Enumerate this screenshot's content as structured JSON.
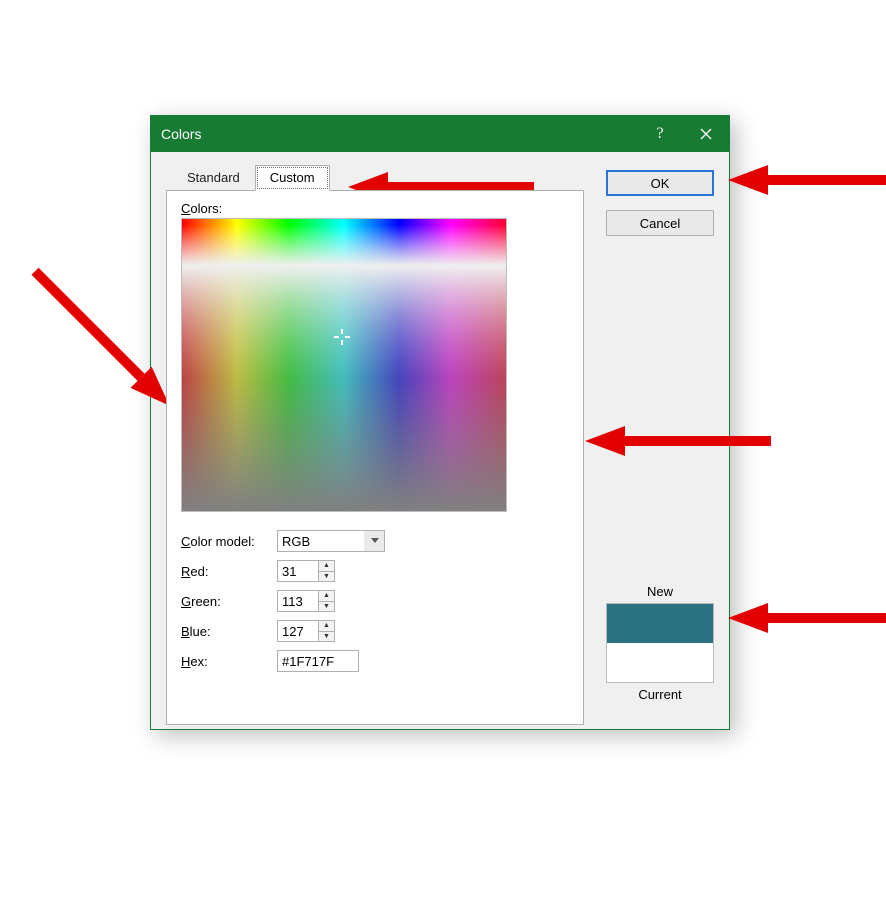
{
  "titlebar": {
    "title": "Colors"
  },
  "tabs": {
    "standard": "Standard",
    "custom": "Custom"
  },
  "buttons": {
    "ok": "OK",
    "cancel": "Cancel"
  },
  "panel": {
    "colors_label": "Colors:",
    "colors_u": "C",
    "model_label_rest": "olor model:",
    "model_u": "C",
    "model_value": "RGB",
    "red_label_rest": "ed:",
    "red_u": "R",
    "red_value": "31",
    "green_label_rest": "reen:",
    "green_u": "G",
    "green_value": "113",
    "blue_label_rest": "lue:",
    "blue_u": "B",
    "blue_value": "127",
    "hex_label_rest": "ex:",
    "hex_u": "H",
    "hex_value": "#1F717F"
  },
  "swatch": {
    "new_label": "New",
    "current_label": "Current",
    "new_color": "#2b7383",
    "current_color": "#ffffff"
  }
}
